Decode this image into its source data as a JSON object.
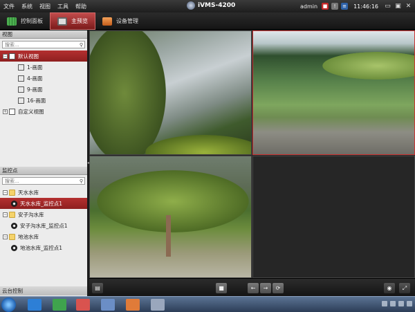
{
  "menubar": {
    "items": [
      "文件",
      "系统",
      "视图",
      "工具",
      "帮助"
    ],
    "app_title": "iVMS-4200",
    "user": "admin",
    "time": "11:46:16"
  },
  "tabs": [
    {
      "label": "控制面板",
      "icon": "grid-icon"
    },
    {
      "label": "主预览",
      "icon": "monitor-icon",
      "active": true
    },
    {
      "label": "设备管理",
      "icon": "device-icon"
    }
  ],
  "view_panel": {
    "title": "视图",
    "search_placeholder": "搜索...",
    "default_view": "默认视图",
    "layouts": [
      "1-画面",
      "4-画面",
      "9-画面",
      "16-画面"
    ],
    "custom_view": "自定义视图"
  },
  "camera_panel": {
    "title": "监控点",
    "search_placeholder": "搜索...",
    "groups": [
      {
        "name": "天水水库",
        "cameras": [
          "天水水库_监控点1"
        ]
      },
      {
        "name": "安子沟水库",
        "cameras": [
          "安子沟水库_监控点1"
        ]
      },
      {
        "name": "地池水库",
        "cameras": [
          "地池水库_监控点1"
        ]
      }
    ]
  },
  "ptz_panel": {
    "title": "云台控制"
  },
  "colors": {
    "accent": "#b43030",
    "background": "#1b1b1b"
  }
}
